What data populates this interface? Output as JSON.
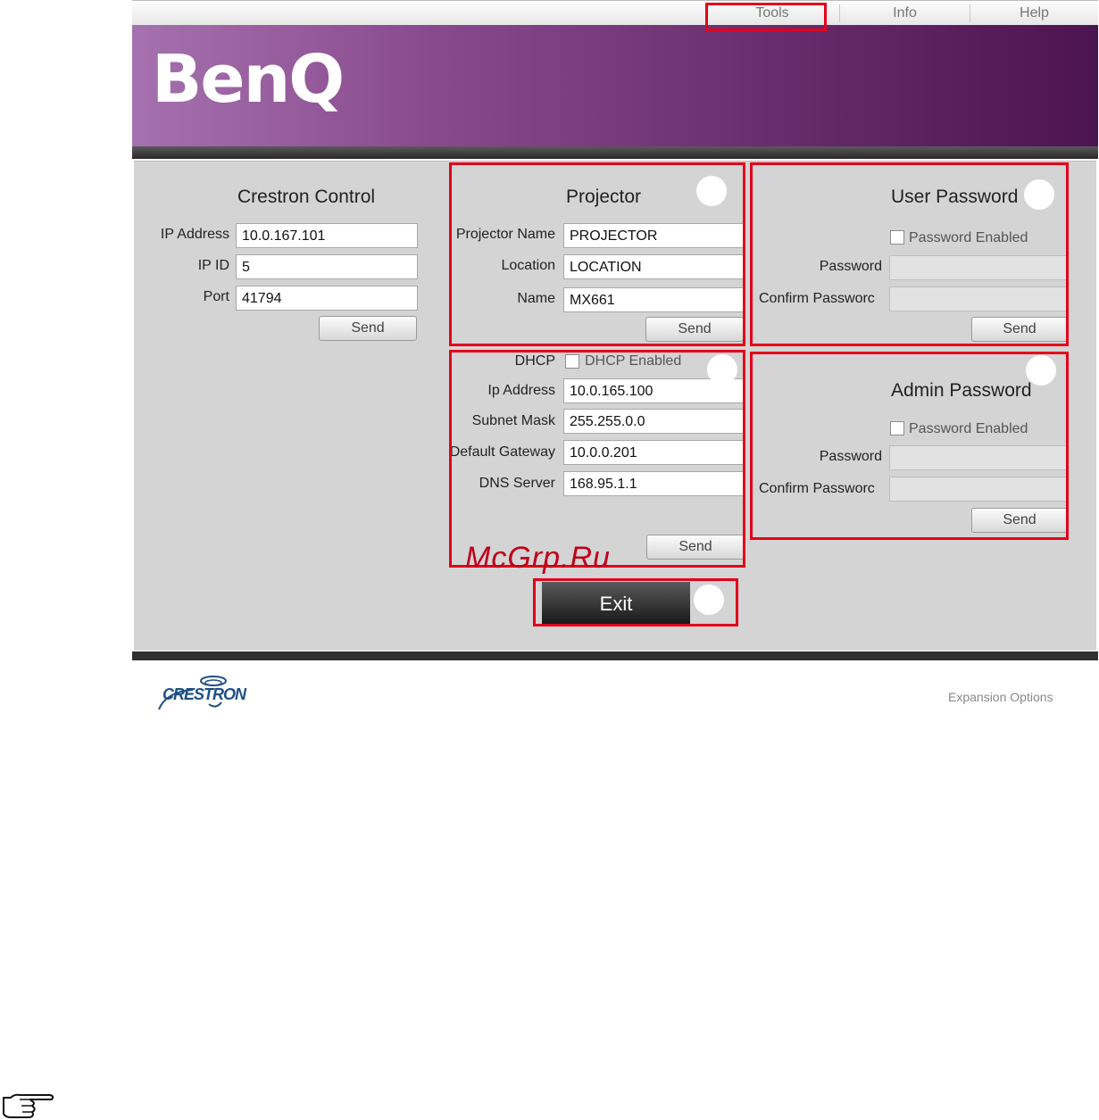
{
  "nav": {
    "tools": "Tools",
    "info": "Info",
    "help": "Help"
  },
  "brand": {
    "logo": "BenQ"
  },
  "crestron_control": {
    "title": "Crestron Control",
    "ip_address_label": "IP Address",
    "ip_address": "10.0.167.101",
    "ip_id_label": "IP ID",
    "ip_id": "5",
    "port_label": "Port",
    "port": "41794",
    "send": "Send"
  },
  "projector": {
    "title": "Projector",
    "projector_name_label": "Projector Name",
    "projector_name": "PROJECTOR",
    "location_label": "Location",
    "location": "LOCATION",
    "name_label": "Name",
    "name": "MX661",
    "send": "Send"
  },
  "network": {
    "dhcp_label": "DHCP",
    "dhcp_checkbox": "DHCP Enabled",
    "dhcp_enabled": false,
    "ip_address_label": "Ip Address",
    "ip_address": "10.0.165.100",
    "subnet_mask_label": "Subnet Mask",
    "subnet_mask": "255.255.0.0",
    "default_gateway_label": "Default Gateway",
    "default_gateway": "10.0.0.201",
    "dns_server_label": "DNS Server",
    "dns_server": "168.95.1.1",
    "send": "Send"
  },
  "user_password": {
    "title": "User Password",
    "checkbox": "Password Enabled",
    "enabled": false,
    "password_label": "Password",
    "confirm_label": "Confirm Passworc",
    "send": "Send"
  },
  "admin_password": {
    "title": "Admin Password",
    "checkbox": "Password Enabled",
    "enabled": false,
    "password_label": "Password",
    "confirm_label": "Confirm Passworc",
    "send": "Send"
  },
  "exit": "Exit",
  "watermark": "McGrp.Ru",
  "footer": {
    "crestron_logo": "CRESTRON",
    "expansion_options": "Expansion Options"
  },
  "colors": {
    "highlight": "#e3001b",
    "banner": "#7a3a7e"
  },
  "icons": {
    "note": "pointing-hand-icon"
  }
}
